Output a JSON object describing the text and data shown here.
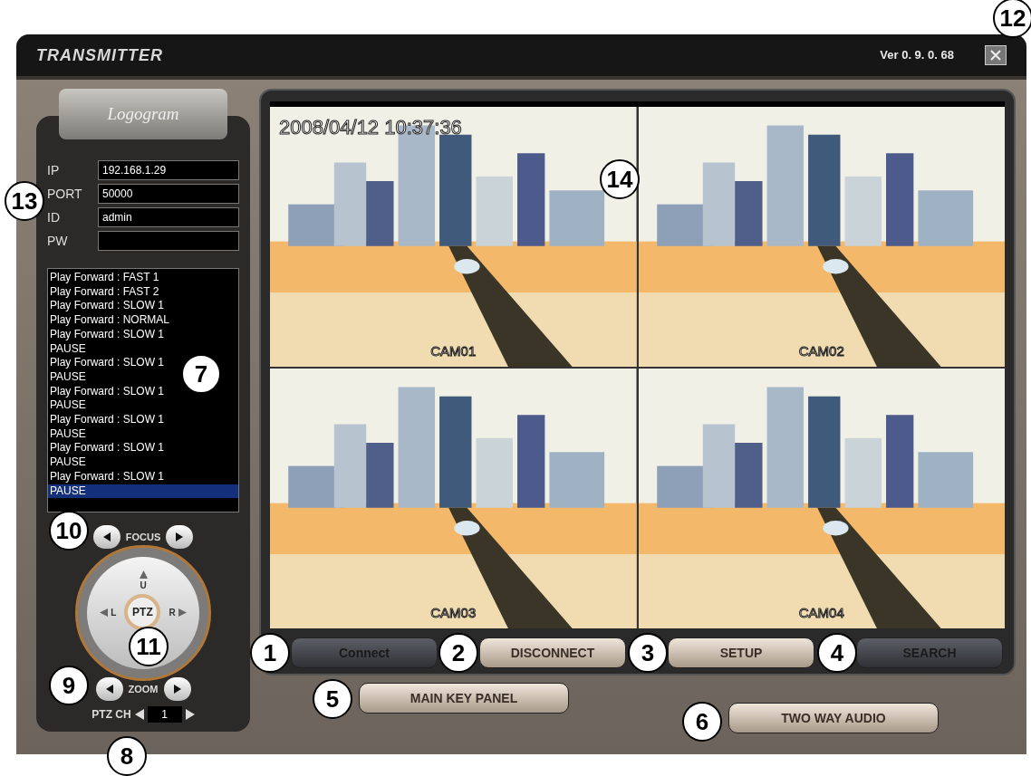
{
  "window": {
    "title": "TRANSMITTER",
    "version": "Ver 0. 9. 0. 68"
  },
  "logo": "Logogram",
  "fields": [
    {
      "label": "IP",
      "value": "192.168.1.29"
    },
    {
      "label": "PORT",
      "value": "50000"
    },
    {
      "label": "ID",
      "value": "admin"
    },
    {
      "label": "PW"
    }
  ],
  "log": [
    {
      "text": "Play Forward : FAST 1",
      "selected": false
    },
    {
      "text": "Play Forward : FAST 2",
      "selected": false
    },
    {
      "text": "Play Forward : SLOW 1",
      "selected": false
    },
    {
      "text": "Play Forward : NORMAL",
      "selected": false
    },
    {
      "text": "Play Forward : SLOW 1",
      "selected": false
    },
    {
      "text": "PAUSE",
      "selected": false
    },
    {
      "text": "Play Forward : SLOW 1",
      "selected": false
    },
    {
      "text": "PAUSE",
      "selected": false
    },
    {
      "text": "Play Forward : SLOW 1",
      "selected": false
    },
    {
      "text": "PAUSE",
      "selected": false
    },
    {
      "text": "Play Forward : SLOW 1",
      "selected": false
    },
    {
      "text": "PAUSE",
      "selected": false
    },
    {
      "text": "Play Forward : SLOW 1",
      "selected": false
    },
    {
      "text": "PAUSE",
      "selected": false
    },
    {
      "text": "Play Forward : SLOW 1",
      "selected": false
    },
    {
      "text": "PAUSE",
      "selected": true
    }
  ],
  "ptz": {
    "focus_label": "FOCUS",
    "zoom_label": "ZOOM",
    "up": "U",
    "left": "L",
    "right": "R",
    "center": "PTZ",
    "channel_label": "PTZ CH",
    "channel": "1"
  },
  "video": {
    "timestamp": "2008/04/12 10:37:36",
    "cameras": [
      {
        "label": "CAM01"
      },
      {
        "label": "CAM02"
      },
      {
        "label": "CAM03"
      },
      {
        "label": "CAM04"
      }
    ]
  },
  "buttons": [
    {
      "label": "Connect",
      "kind": "dark"
    },
    {
      "label": "DISCONNECT",
      "kind": "light"
    },
    {
      "label": "SETUP",
      "kind": "light"
    },
    {
      "label": "SEARCH",
      "kind": "dark"
    }
  ],
  "main_key_panel": "MAIN KEY PANEL",
  "two_way_audio": "TWO WAY AUDIO",
  "callouts": [
    "1",
    "2",
    "3",
    "4",
    "5",
    "6",
    "7",
    "8",
    "9",
    "10",
    "11",
    "12",
    "13",
    "14"
  ]
}
